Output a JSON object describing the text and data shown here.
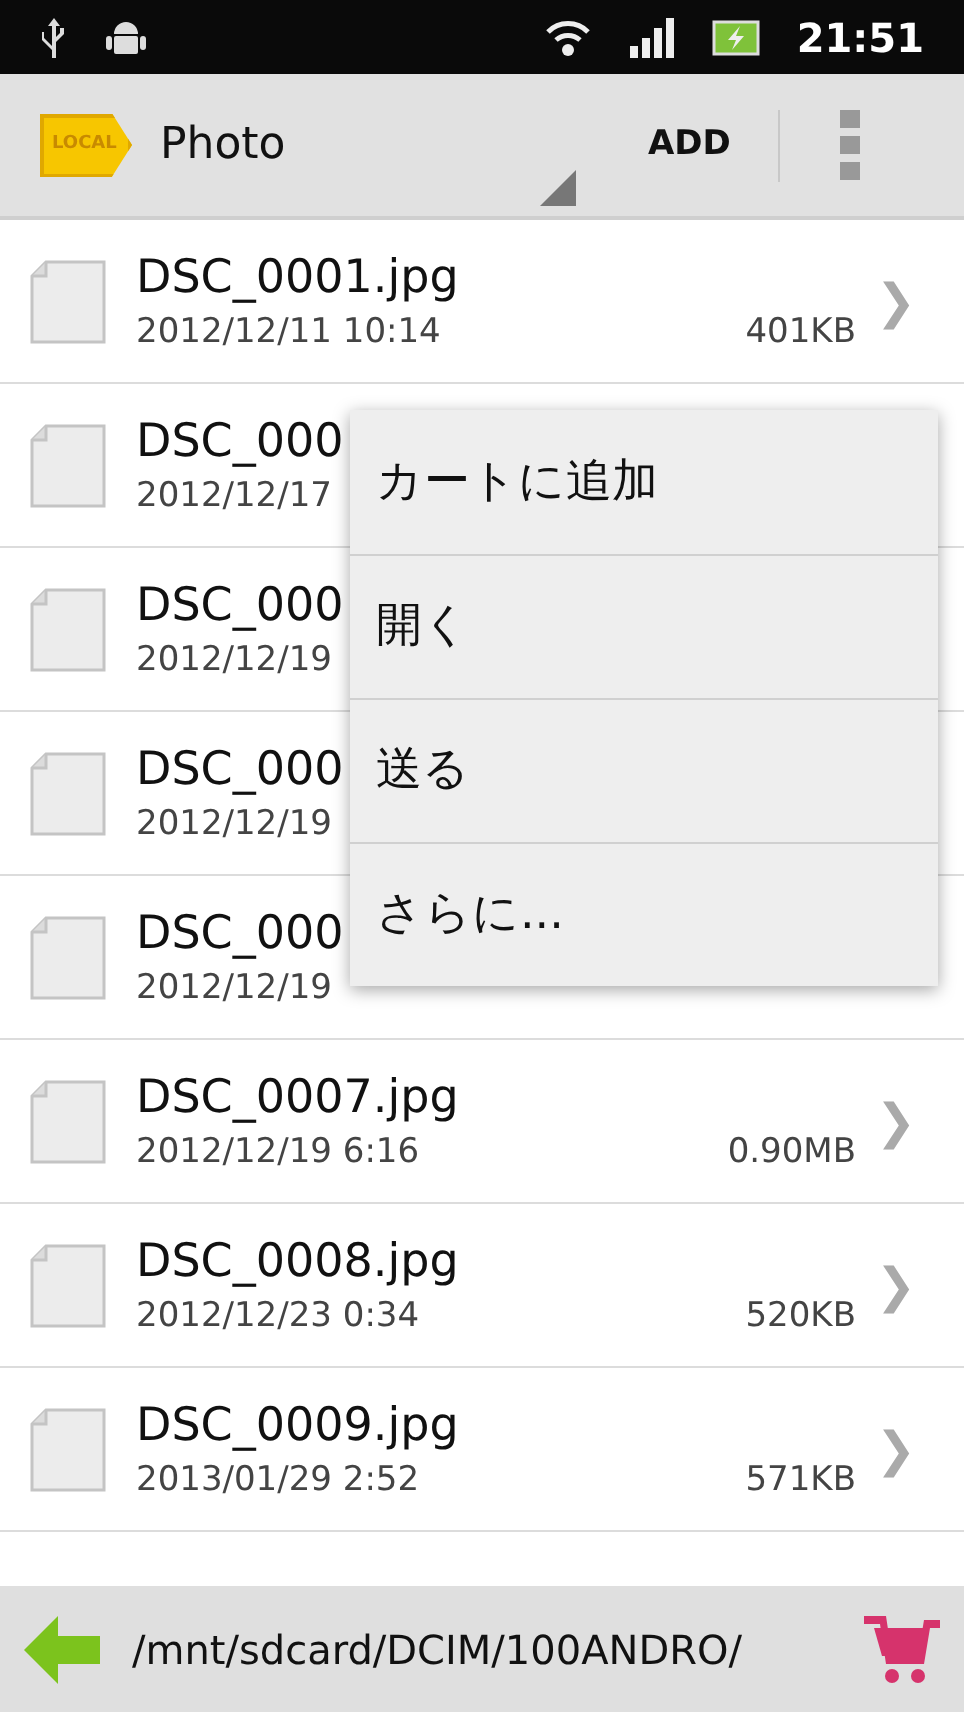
{
  "status_bar": {
    "time": "21:51"
  },
  "header": {
    "badge": "LOCAL",
    "title": "Photo",
    "action": "ADD"
  },
  "files": [
    {
      "name": "DSC_0001.jpg",
      "date": "2012/12/11 10:14",
      "size": "401KB",
      "chevron": "❯"
    },
    {
      "name": "DSC_000",
      "date": "2012/12/17"
    },
    {
      "name": "DSC_000",
      "date": "2012/12/19"
    },
    {
      "name": "DSC_000",
      "date": "2012/12/19"
    },
    {
      "name": "DSC_000",
      "date": "2012/12/19"
    },
    {
      "name": "DSC_0007.jpg",
      "date": "2012/12/19 6:16",
      "size": "0.90MB",
      "chevron": "❯"
    },
    {
      "name": "DSC_0008.jpg",
      "date": "2012/12/23 0:34",
      "size": "520KB",
      "chevron": "❯"
    },
    {
      "name": "DSC_0009.jpg",
      "date": "2013/01/29 2:52",
      "size": "571KB",
      "chevron": "❯"
    }
  ],
  "context_menu": [
    "カートに追加",
    "開く",
    "送る",
    "さらに..."
  ],
  "footer": {
    "path": "/mnt/sdcard/DCIM/100ANDRO/"
  }
}
